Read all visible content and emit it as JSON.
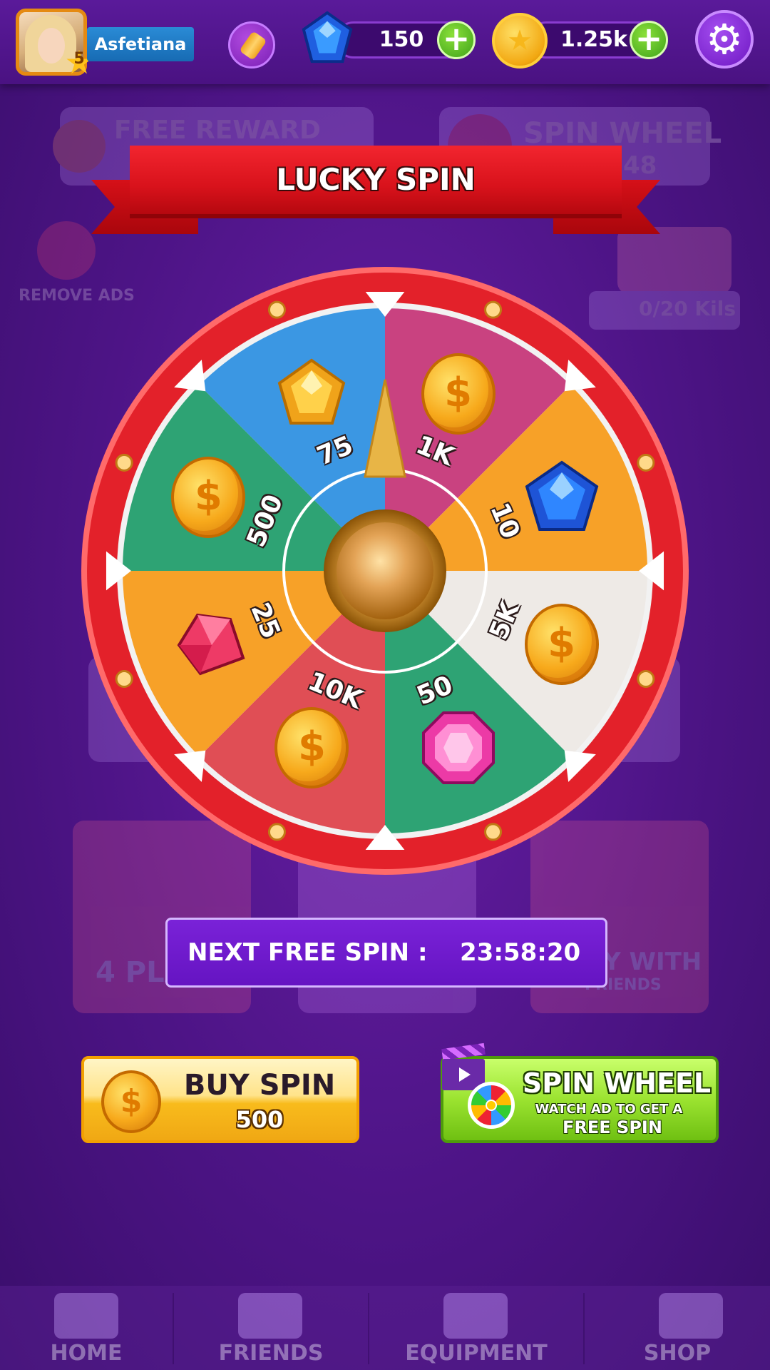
{
  "profile": {
    "username": "Asfetiana",
    "level": "5"
  },
  "currencies": {
    "gems": "150",
    "coins": "1.25k"
  },
  "title": "LUCKY SPIN",
  "wheel": {
    "segments": [
      {
        "label": "500",
        "reward": "coin",
        "color": "#2ea374"
      },
      {
        "label": "75",
        "reward": "yellow-gem",
        "color": "#3b97e3"
      },
      {
        "label": "1K",
        "reward": "coin",
        "color": "#c94280"
      },
      {
        "label": "10",
        "reward": "blue-gem",
        "color": "#f7a128"
      },
      {
        "label": "5K",
        "reward": "coin",
        "color": "#eeeae6"
      },
      {
        "label": "50",
        "reward": "pink-gem",
        "color": "#2ea374"
      },
      {
        "label": "10K",
        "reward": "coin",
        "color": "#e04e55"
      },
      {
        "label": "25",
        "reward": "ruby",
        "color": "#f7a128"
      }
    ],
    "rim_color": "#e3212a"
  },
  "next_spin": {
    "label": "NEXT FREE SPIN :",
    "time": "23:58:20"
  },
  "buy_spin": {
    "title": "BUY SPIN",
    "price": "500"
  },
  "ad_spin": {
    "title": "SPIN WHEEL",
    "line1": "WATCH AD TO GET A",
    "line2": "FREE SPIN"
  },
  "background_overlay": {
    "free_reward": "FREE REWARD",
    "spin_wheel": "SPIN WHEEL",
    "timer_fragment": "48",
    "remove_ads": "REMOVE ADS",
    "kits": "0/20 Kils",
    "four_player": "4 PLA",
    "play_with": "Y WITH",
    "friends_small": "FRIENDS"
  },
  "nav": [
    {
      "label": "HOME",
      "icon": "home-icon"
    },
    {
      "label": "FRIENDS",
      "icon": "friends-icon"
    },
    {
      "label": "EQUIPMENT",
      "icon": "dice-icon"
    },
    {
      "label": "SHOP",
      "icon": "shop-icon"
    }
  ]
}
